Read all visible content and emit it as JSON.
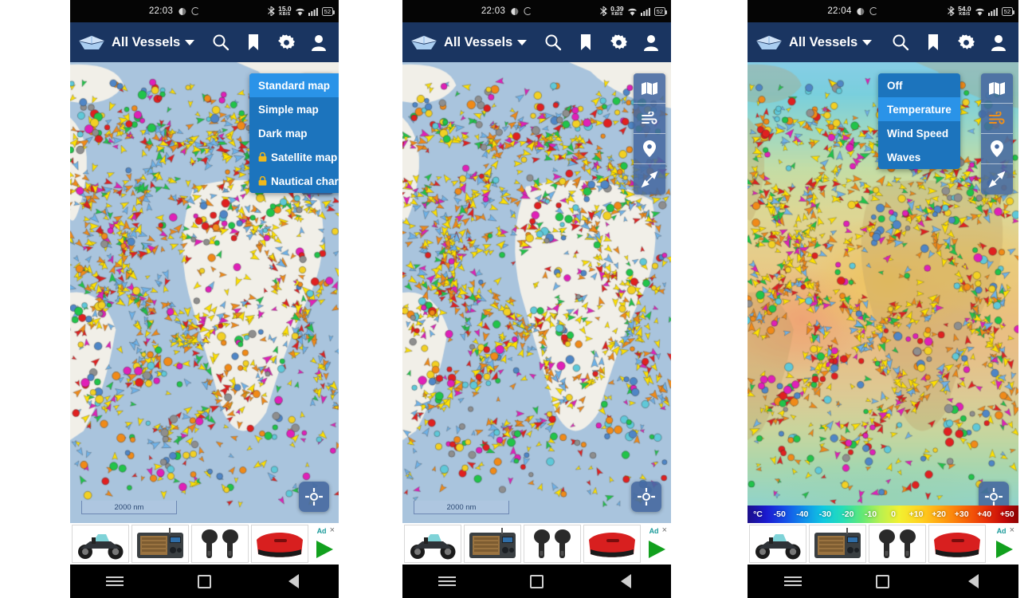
{
  "app": {
    "title": "All Vessels",
    "logo_icon": "paper-boat-logo",
    "toolbar_icons": [
      "search-icon",
      "bookmark-icon",
      "gear-icon",
      "account-icon"
    ]
  },
  "panels": [
    {
      "id": "panel-1",
      "status": {
        "time": "22:03",
        "net_rate": "15.0",
        "net_unit": "KB/S",
        "battery": "52"
      },
      "map_style": "standard",
      "scale_label": "2000 nm",
      "menu": {
        "name": "map-style-menu",
        "items": [
          {
            "label": "Standard map",
            "selected": true,
            "locked": false
          },
          {
            "label": "Simple map",
            "selected": false,
            "locked": false
          },
          {
            "label": "Dark map",
            "selected": false,
            "locked": false
          },
          {
            "label": "Satellite map",
            "selected": false,
            "locked": true
          },
          {
            "label": "Nautical charts",
            "selected": false,
            "locked": true
          }
        ]
      },
      "weather_overlay": false,
      "legend": null
    },
    {
      "id": "panel-2",
      "status": {
        "time": "22:03",
        "net_rate": "0.39",
        "net_unit": "KB/S",
        "battery": "52"
      },
      "map_style": "standard",
      "scale_label": "2000 nm",
      "menu": null,
      "weather_overlay": false,
      "legend": null
    },
    {
      "id": "panel-3",
      "status": {
        "time": "22:04",
        "net_rate": "54.0",
        "net_unit": "KB/S",
        "battery": "52"
      },
      "map_style": "standard",
      "scale_label": null,
      "menu": {
        "name": "weather-layer-menu",
        "items": [
          {
            "label": "Off",
            "selected": false,
            "locked": false
          },
          {
            "label": "Temperature",
            "selected": true,
            "locked": false
          },
          {
            "label": "Wind Speed",
            "selected": false,
            "locked": false
          },
          {
            "label": "Waves",
            "selected": false,
            "locked": false
          }
        ]
      },
      "weather_overlay": true,
      "legend": {
        "unit": "°C",
        "ticks": [
          "-50",
          "-40",
          "-30",
          "-20",
          "-10",
          "0",
          "+10",
          "+20",
          "+30",
          "+40",
          "+50"
        ]
      }
    }
  ],
  "map_controls": {
    "buttons": [
      {
        "name": "map-layers-button",
        "icon": "map-icon"
      },
      {
        "name": "weather-button",
        "icon": "wind-icon"
      },
      {
        "name": "places-button",
        "icon": "location-pin-icon"
      },
      {
        "name": "navigate-button",
        "icon": "compass-icon"
      }
    ],
    "locate": {
      "name": "locate-me-button",
      "icon": "crosshair-icon"
    }
  },
  "ad": {
    "label": "Ad",
    "close": "×",
    "products": [
      "go-kart",
      "radio",
      "earbuds",
      "red-bag"
    ]
  },
  "navbar": {
    "items": [
      "recents-button",
      "home-button",
      "back-button"
    ]
  },
  "colors": {
    "appbar": "#1a3561",
    "menu_bg": "#1c74bd",
    "menu_selected": "#2a93e8",
    "sea": "#a9c4dd",
    "land": "#f1efe8",
    "vessel_yellow": "#ffe100",
    "vessel_orange": "#f08a18",
    "vessel_blue": "#6fb2e8",
    "vessel_magenta": "#e020b8",
    "ad_green": "#12a01e"
  }
}
